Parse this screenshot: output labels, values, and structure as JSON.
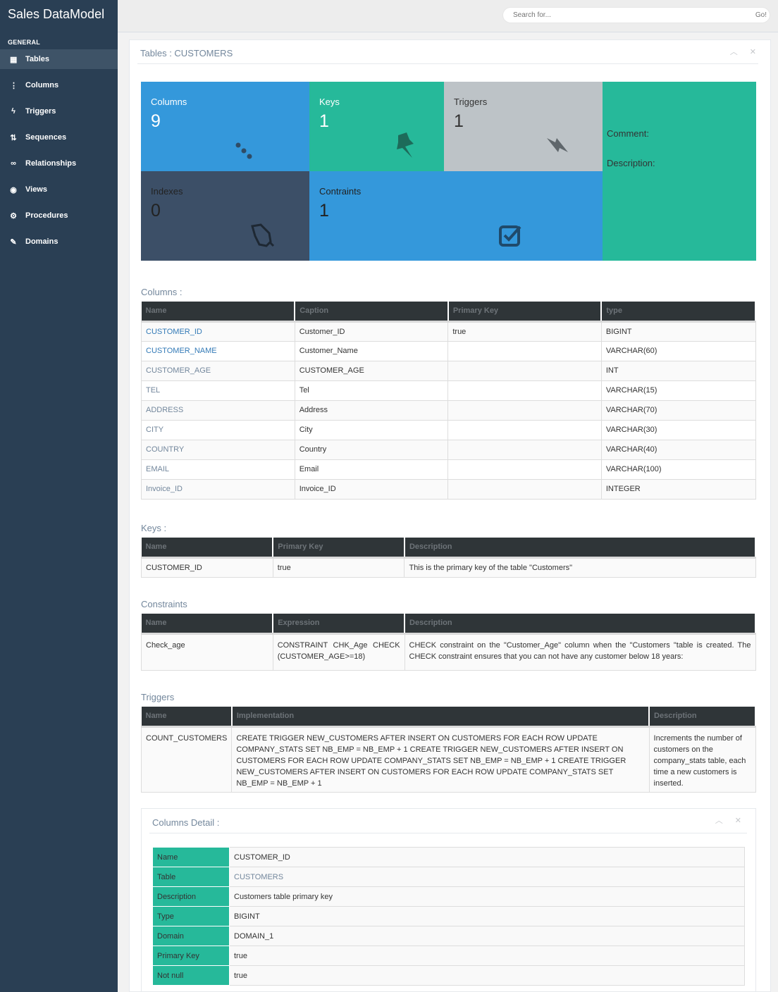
{
  "app": {
    "title": "Sales DataModel"
  },
  "sidebar": {
    "section": "GENERAL",
    "items": [
      {
        "label": "Tables",
        "icon": "grid-icon",
        "glyph": "▦"
      },
      {
        "label": "Columns",
        "icon": "vertical-ellipsis-icon",
        "glyph": "⋮"
      },
      {
        "label": "Triggers",
        "icon": "bolt-icon",
        "glyph": "ϟ"
      },
      {
        "label": "Sequences",
        "icon": "sort-numeric-icon",
        "glyph": "⇅"
      },
      {
        "label": "Relationships",
        "icon": "link-icon",
        "glyph": "∞"
      },
      {
        "label": "Views",
        "icon": "eye-icon",
        "glyph": "◉"
      },
      {
        "label": "Procedures",
        "icon": "gear-icon",
        "glyph": "⚙"
      },
      {
        "label": "Domains",
        "icon": "wrench-icon",
        "glyph": "✎"
      }
    ]
  },
  "search": {
    "placeholder": "Search for...",
    "go_label": "Go!"
  },
  "panel": {
    "title": "Tables : CUSTOMERS"
  },
  "tiles": {
    "columns": {
      "label": "Columns",
      "value": "9"
    },
    "keys": {
      "label": "Keys",
      "value": "1"
    },
    "triggers": {
      "label": "Triggers",
      "value": "1"
    },
    "indexes": {
      "label": "Indexes",
      "value": "0"
    },
    "constraints": {
      "label": "Contraints",
      "value": "1"
    },
    "comment_label": "Comment:",
    "description_label": "Description:"
  },
  "colors": {
    "blue": "#3498db",
    "green": "#26b99a",
    "gray": "#bdc3c7",
    "navy": "#3c4f67"
  },
  "columns_section": {
    "title": "Columns :",
    "headers": [
      "Name",
      "Caption",
      "Primary Key",
      "type"
    ],
    "rows": [
      [
        "CUSTOMER_ID",
        "Customer_ID",
        "true",
        "BIGINT"
      ],
      [
        "CUSTOMER_NAME",
        "Customer_Name",
        "",
        "VARCHAR(60)"
      ],
      [
        "CUSTOMER_AGE",
        "CUSTOMER_AGE",
        "",
        "INT"
      ],
      [
        "TEL",
        "Tel",
        "",
        "VARCHAR(15)"
      ],
      [
        "ADDRESS",
        "Address",
        "",
        "VARCHAR(70)"
      ],
      [
        "CITY",
        "City",
        "",
        "VARCHAR(30)"
      ],
      [
        "COUNTRY",
        "Country",
        "",
        "VARCHAR(40)"
      ],
      [
        "EMAIL",
        "Email",
        "",
        "VARCHAR(100)"
      ],
      [
        "Invoice_ID",
        "Invoice_ID",
        "",
        "INTEGER"
      ]
    ]
  },
  "keys_section": {
    "title": "Keys :",
    "headers": [
      "Name",
      "Primary Key",
      "Description"
    ],
    "rows": [
      [
        "CUSTOMER_ID",
        "true",
        "This is the primary key of the table \"Customers\""
      ]
    ]
  },
  "constraints_section": {
    "title": "Constraints",
    "headers": [
      "Name",
      "Expression",
      "Description"
    ],
    "rows": [
      [
        "Check_age",
        "CONSTRAINT CHK_Age CHECK (CUSTOMER_AGE>=18)",
        "CHECK constraint on the \"Customer_Age\" column when the \"Customers \"table is created. The CHECK constraint ensures that you can not have any customer below 18 years:"
      ]
    ]
  },
  "triggers_section": {
    "title": "Triggers",
    "headers": [
      "Name",
      "Implementation",
      "Description"
    ],
    "rows": [
      [
        "COUNT_CUSTOMERS",
        "CREATE TRIGGER NEW_CUSTOMERS AFTER INSERT ON CUSTOMERS FOR EACH ROW UPDATE COMPANY_STATS SET NB_EMP = NB_EMP + 1 CREATE TRIGGER NEW_CUSTOMERS AFTER INSERT ON CUSTOMERS FOR EACH ROW UPDATE COMPANY_STATS SET NB_EMP = NB_EMP + 1 CREATE TRIGGER NEW_CUSTOMERS AFTER INSERT ON CUSTOMERS FOR EACH ROW UPDATE COMPANY_STATS SET NB_EMP = NB_EMP + 1",
        "Increments the number of customers on the company_stats table, each time a new customers is inserted."
      ]
    ]
  },
  "columns_detail": {
    "title": "Columns Detail :",
    "rows": [
      {
        "key": "Name",
        "value": "CUSTOMER_ID"
      },
      {
        "key": "Table",
        "value": "CUSTOMERS"
      },
      {
        "key": "Description",
        "value": "Customers table primary key"
      },
      {
        "key": "Type",
        "value": "BIGINT"
      },
      {
        "key": "Domain",
        "value": "DOMAIN_1"
      },
      {
        "key": "Primary Key",
        "value": "true"
      },
      {
        "key": "Not null",
        "value": "true"
      }
    ]
  }
}
